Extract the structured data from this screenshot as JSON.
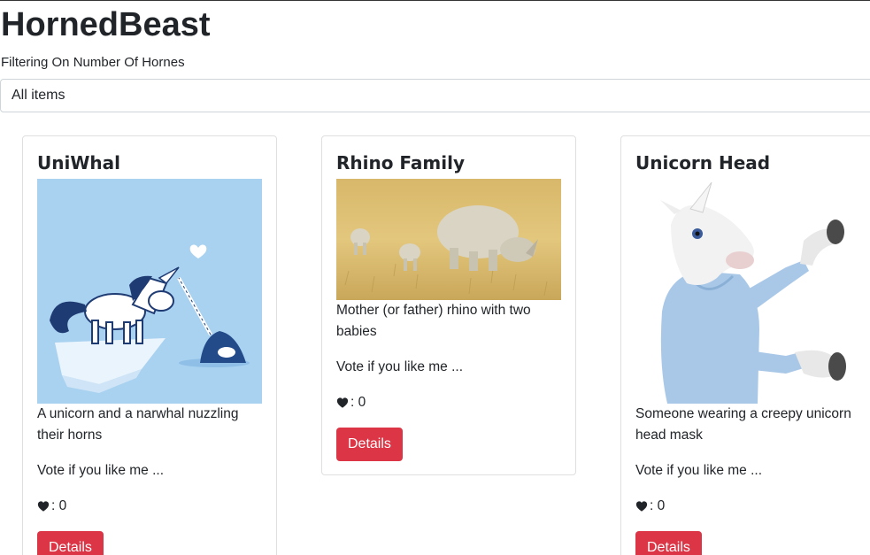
{
  "header": {
    "title": "HornedBeast"
  },
  "filter": {
    "label": "Filtering On Number Of Hornes",
    "selected": "All items"
  },
  "cards": [
    {
      "title": "UniWhal",
      "image_icon": "unicorn-narwhal-illustration",
      "description": "A unicorn and a narwhal nuzzling their horns",
      "vote_text": "Vote if you like me ...",
      "likes_label": ": 0",
      "button_label": "Details"
    },
    {
      "title": "Rhino Family",
      "image_icon": "rhino-family-photo",
      "description": "Mother (or father) rhino with two babies",
      "vote_text": "Vote if you like me ...",
      "likes_label": ": 0",
      "button_label": "Details"
    },
    {
      "title": "Unicorn Head",
      "image_icon": "unicorn-mask-photo",
      "description": "Someone wearing a creepy unicorn head mask",
      "vote_text": "Vote if you like me ...",
      "likes_label": ": 0",
      "button_label": "Details"
    }
  ],
  "colors": {
    "button": "#dc3545",
    "uniwhal_bg": "#a9d1f0"
  }
}
